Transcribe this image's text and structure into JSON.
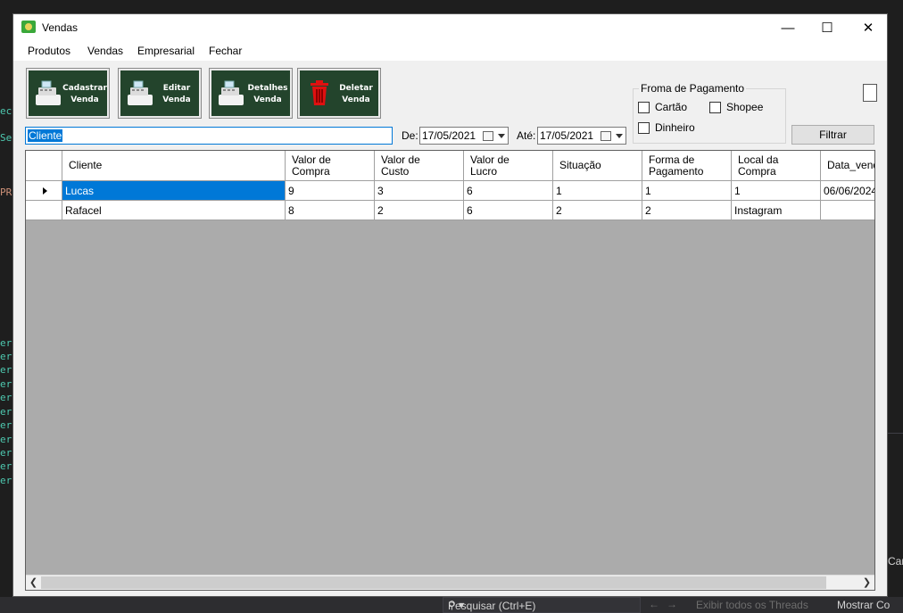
{
  "ide": {
    "left_fragments": [
      "ect",
      "Set",
      "PRE",
      "ert",
      "ert",
      "ert",
      "ert",
      "ert",
      "ert",
      "ert",
      "ert",
      "ert",
      "ert",
      "ert"
    ],
    "bottom_search_placeholder": "Pesquisar (Ctrl+E)",
    "bottom_threads": "Exibir todos os Threads",
    "bottom_show": "Mostrar Co",
    "right_fragment": "Cara"
  },
  "window": {
    "title": "Vendas",
    "minimize": "—",
    "maximize": "☐",
    "close": "✕"
  },
  "menu": {
    "items": [
      "Produtos",
      "Vendas",
      "Empresarial",
      "Fechar"
    ]
  },
  "toolbar": {
    "buttons": [
      {
        "label": "Cadastrar\nVenda",
        "icon": "cash-register-icon"
      },
      {
        "label": "Editar\nVenda",
        "icon": "cash-register-icon"
      },
      {
        "label": "Detalhes\nVenda",
        "icon": "cash-register-icon"
      },
      {
        "label": "Deletar\nVenda",
        "icon": "trash-icon"
      }
    ]
  },
  "payment": {
    "title": "Froma de Pagamento",
    "options": [
      "Cartão",
      "Shopee",
      "Dinheiro"
    ]
  },
  "filters": {
    "client_value": "Cliente",
    "from_label": "De:",
    "from_date": "17/05/2021",
    "to_label": "Até:",
    "to_date": "17/05/2021",
    "filter_button": "Filtrar"
  },
  "grid": {
    "columns": [
      "Cliente",
      "Valor de\nCompra",
      "Valor de\nCusto",
      "Valor de\nLucro",
      "Situação",
      "Forma de\nPagamento",
      "Local da\nCompra",
      "Data_venda"
    ],
    "rows": [
      [
        "Lucas",
        "9",
        "3",
        "6",
        "1",
        "1",
        "1",
        "06/06/2024"
      ],
      [
        "Rafacel",
        "8",
        "2",
        "6",
        "2",
        "2",
        "Instagram",
        ""
      ]
    ]
  },
  "colors": {
    "accent": "#0078d7",
    "toolbar_button_bg": "#23442c",
    "grid_empty_bg": "#ababab"
  }
}
